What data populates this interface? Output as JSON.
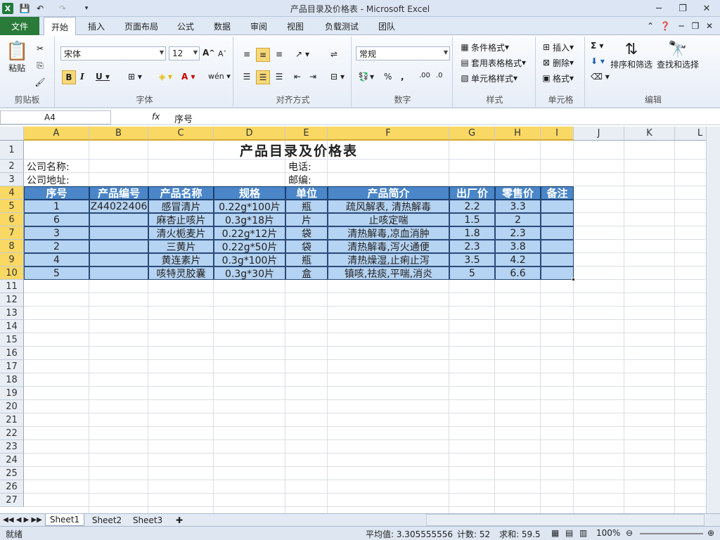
{
  "window": {
    "title": "产品目录及价格表 - Microsoft Excel"
  },
  "menu": {
    "file": "文件",
    "tabs": [
      "开始",
      "插入",
      "页面布局",
      "公式",
      "数据",
      "审阅",
      "视图",
      "负载测试",
      "团队"
    ]
  },
  "ribbon": {
    "clipboard": {
      "label": "剪贴板",
      "paste": "粘贴"
    },
    "font": {
      "label": "字体",
      "name": "宋体",
      "size": "12"
    },
    "alignment": {
      "label": "对齐方式"
    },
    "number": {
      "label": "数字",
      "format": "常规"
    },
    "styles": {
      "label": "样式",
      "conditional": "条件格式",
      "table": "套用表格格式",
      "cell": "单元格样式"
    },
    "cells": {
      "label": "单元格",
      "insert": "插入",
      "delete": "删除",
      "format": "格式"
    },
    "editing": {
      "label": "编辑",
      "sort": "排序和筛选",
      "find": "查找和选择"
    }
  },
  "formula_bar": {
    "name_box": "A4",
    "fx": "fx",
    "content": "序号"
  },
  "columns": [
    "A",
    "B",
    "C",
    "D",
    "E",
    "F",
    "G",
    "H",
    "I",
    "J",
    "K",
    "L"
  ],
  "rows": [
    "1",
    "2",
    "3",
    "4",
    "5",
    "6",
    "7",
    "8",
    "9",
    "10",
    "11",
    "12",
    "13",
    "14",
    "15",
    "16",
    "17",
    "18",
    "19",
    "20",
    "21",
    "22",
    "23",
    "24",
    "25",
    "26",
    "27"
  ],
  "sheet": {
    "title": "产品目录及价格表",
    "company_name_label": "公司名称:",
    "phone_label": "电话:",
    "company_addr_label": "公司地址:",
    "zip_label": "邮编:",
    "headers": [
      "序号",
      "产品编号",
      "产品名称",
      "规格",
      "单位",
      "产品简介",
      "出厂价",
      "零售价",
      "备注"
    ],
    "data": [
      [
        "1",
        "Z44022406",
        "感冒清片",
        "0.22g*100片",
        "瓶",
        "疏风解表, 清热解毒",
        "2.2",
        "3.3",
        ""
      ],
      [
        "6",
        "",
        "麻杏止咳片",
        "0.3g*18片",
        "片",
        "止咳定喘",
        "1.5",
        "2",
        ""
      ],
      [
        "3",
        "",
        "清火栀麦片",
        "0.22g*12片",
        "袋",
        "清热解毒,凉血消肿",
        "1.8",
        "2.3",
        ""
      ],
      [
        "2",
        "",
        "三黄片",
        "0.22g*50片",
        "袋",
        "清热解毒,泻火通便",
        "2.3",
        "3.8",
        ""
      ],
      [
        "4",
        "",
        "黄连素片",
        "0.3g*100片",
        "瓶",
        "清热燥湿,止痢止泻",
        "3.5",
        "4.2",
        ""
      ],
      [
        "5",
        "",
        "咳特灵胶囊",
        "0.3g*30片",
        "盒",
        "镇咳,祛痰,平喘,消炎",
        "5",
        "6.6",
        ""
      ]
    ]
  },
  "sheet_tabs": [
    "Sheet1",
    "Sheet2",
    "Sheet3"
  ],
  "status": {
    "ready": "就绪",
    "average": "平均值: 3.305555556",
    "count": "计数: 52",
    "sum": "求和: 59.5",
    "zoom": "100%"
  }
}
